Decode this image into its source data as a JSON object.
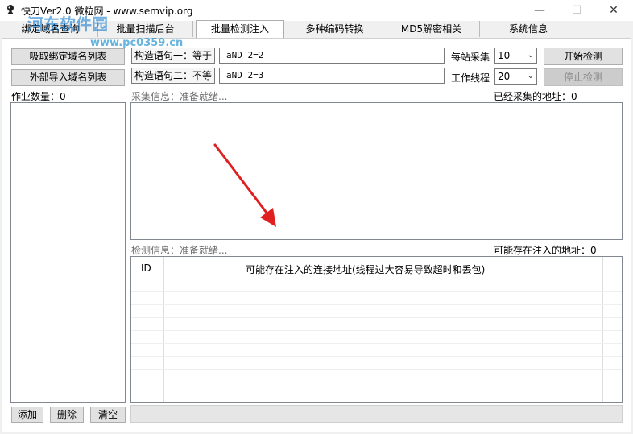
{
  "window": {
    "title": "快刀Ver2.0   微粒网 - www.semvip.org",
    "min_glyph": "—",
    "max_glyph": "☐",
    "close_glyph": "✕"
  },
  "watermark": {
    "text": "河东软件园",
    "url": "www.pc0359.cn"
  },
  "tabs": [
    {
      "label": "绑定域名查询"
    },
    {
      "label": "批量扫描后台"
    },
    {
      "label": "批量检测注入",
      "active": true
    },
    {
      "label": "多种编码转换"
    },
    {
      "label": "MD5解密相关"
    },
    {
      "label": "系统信息"
    }
  ],
  "left": {
    "fetch_button": "吸取绑定域名列表",
    "import_button": "外部导入域名列表",
    "job_count_label": "作业数量：0",
    "add_button": "添加",
    "delete_button": "删除",
    "clear_button": "清空"
  },
  "config": {
    "stmt1_label": "构造语句一：等于",
    "stmt1_value": "aND 2=2",
    "stmt2_label": "构造语句二：不等",
    "stmt2_value": "aND 2=3",
    "per_site_label": "每站采集",
    "per_site_value": "10",
    "threads_label": "工作线程",
    "threads_value": "20",
    "start_button": "开始检测",
    "stop_button": "停止检测"
  },
  "collect": {
    "status": "采集信息：准备就绪...",
    "count_label": "已经采集的地址：0"
  },
  "detect": {
    "status": "检测信息：准备就绪...",
    "count_label": "可能存在注入的地址：0",
    "columns": [
      "ID",
      "可能存在注入的连接地址(线程过大容易导致超时和丢包)"
    ]
  },
  "colors": {
    "window_bg": "#f0f0f0",
    "panel_bg": "#ffffff",
    "button_bg": "#e1e1e1",
    "annotation_arrow": "#e02020"
  }
}
